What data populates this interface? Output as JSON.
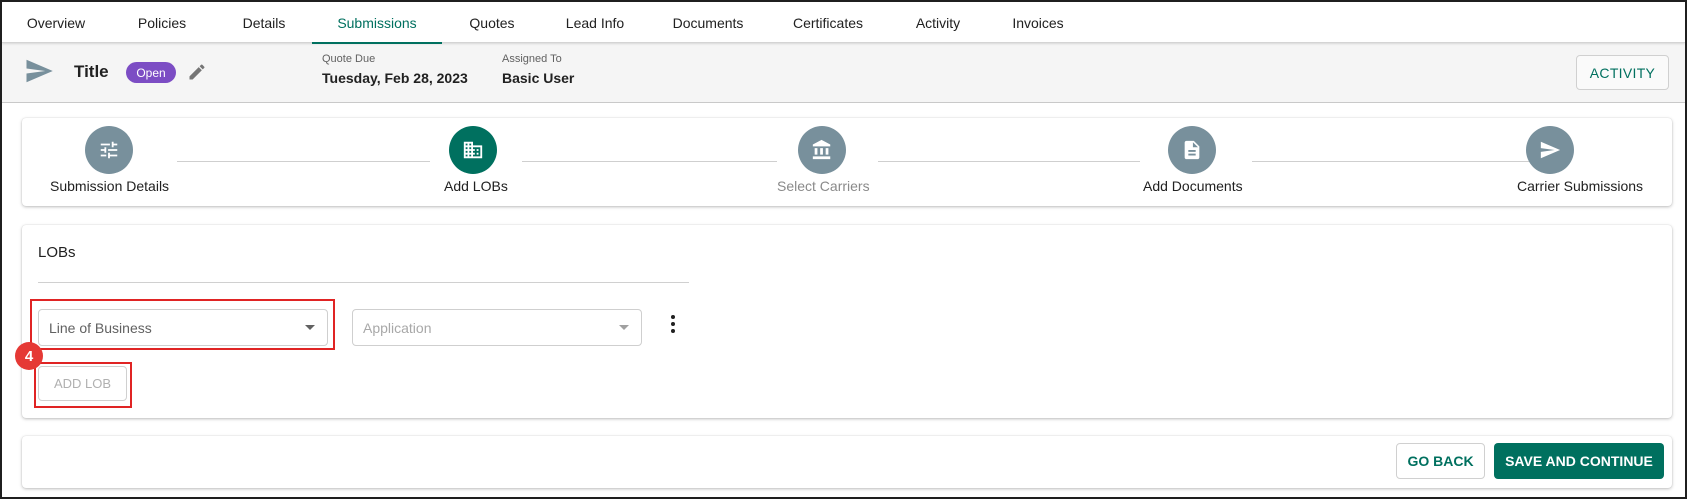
{
  "tabs": [
    {
      "label": "Overview",
      "active": false
    },
    {
      "label": "Policies",
      "active": false
    },
    {
      "label": "Details",
      "active": false
    },
    {
      "label": "Submissions",
      "active": true
    },
    {
      "label": "Quotes",
      "active": false
    },
    {
      "label": "Lead Info",
      "active": false
    },
    {
      "label": "Documents",
      "active": false
    },
    {
      "label": "Certificates",
      "active": false
    },
    {
      "label": "Activity",
      "active": false
    },
    {
      "label": "Invoices",
      "active": false
    }
  ],
  "header": {
    "title": "Title",
    "status_badge": "Open",
    "quote_due_label": "Quote Due",
    "quote_due_value": "Tuesday, Feb 28, 2023",
    "assigned_to_label": "Assigned To",
    "assigned_to_value": "Basic User",
    "activity_button": "ACTIVITY"
  },
  "stepper": {
    "steps": [
      {
        "label": "Submission Details",
        "icon": "tune-sliders-icon",
        "state": "complete"
      },
      {
        "label": "Add LOBs",
        "icon": "building-icon",
        "state": "active"
      },
      {
        "label": "Select Carriers",
        "icon": "bank-icon",
        "state": "pending"
      },
      {
        "label": "Add Documents",
        "icon": "document-icon",
        "state": "complete"
      },
      {
        "label": "Carrier Submissions",
        "icon": "send-icon",
        "state": "complete"
      }
    ]
  },
  "lobs": {
    "title": "LOBs",
    "line_of_business_placeholder": "Line of Business",
    "application_placeholder": "Application",
    "add_lob_button": "ADD LOB"
  },
  "annotation": {
    "marker_number": "4",
    "highlight_color": "#e02424"
  },
  "actions": {
    "go_back_button": "GO BACK",
    "save_continue_button": "SAVE AND CONTINUE"
  },
  "colors": {
    "accent": "#00705f",
    "badge": "#7c4dc4",
    "step_inactive": "#78909c"
  }
}
